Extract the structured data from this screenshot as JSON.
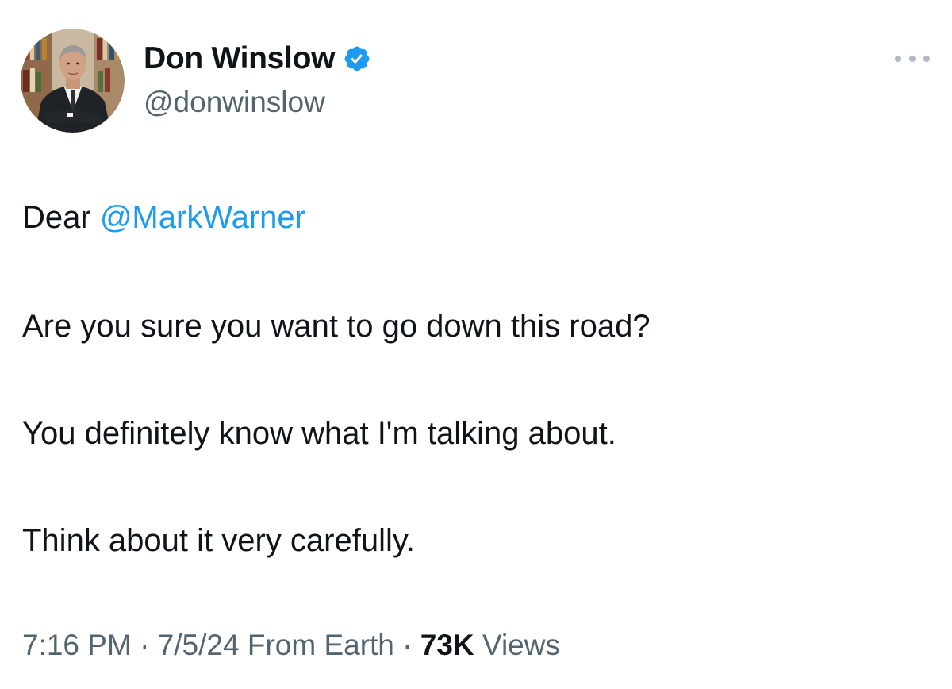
{
  "author": {
    "display_name": "Don Winslow",
    "handle": "@donwinslow",
    "verified": true,
    "verified_color": "#1d9bf0"
  },
  "tweet": {
    "greeting": "Dear",
    "mention": "@MarkWarner",
    "lines": [
      "Are you sure you want to go down this road?",
      "You definitely know what I'm talking about.",
      "Think about it very carefully."
    ]
  },
  "meta": {
    "time": "7:16 PM",
    "separator": "·",
    "date": "7/5/24",
    "source": "From Earth",
    "views_count": "73K",
    "views_label": "Views"
  },
  "icons": {
    "verified": "verified-badge-icon",
    "more": "more-options-icon"
  },
  "colors": {
    "link": "#1d9bf0",
    "secondary_text": "#536471",
    "primary_text": "#0f1419"
  }
}
